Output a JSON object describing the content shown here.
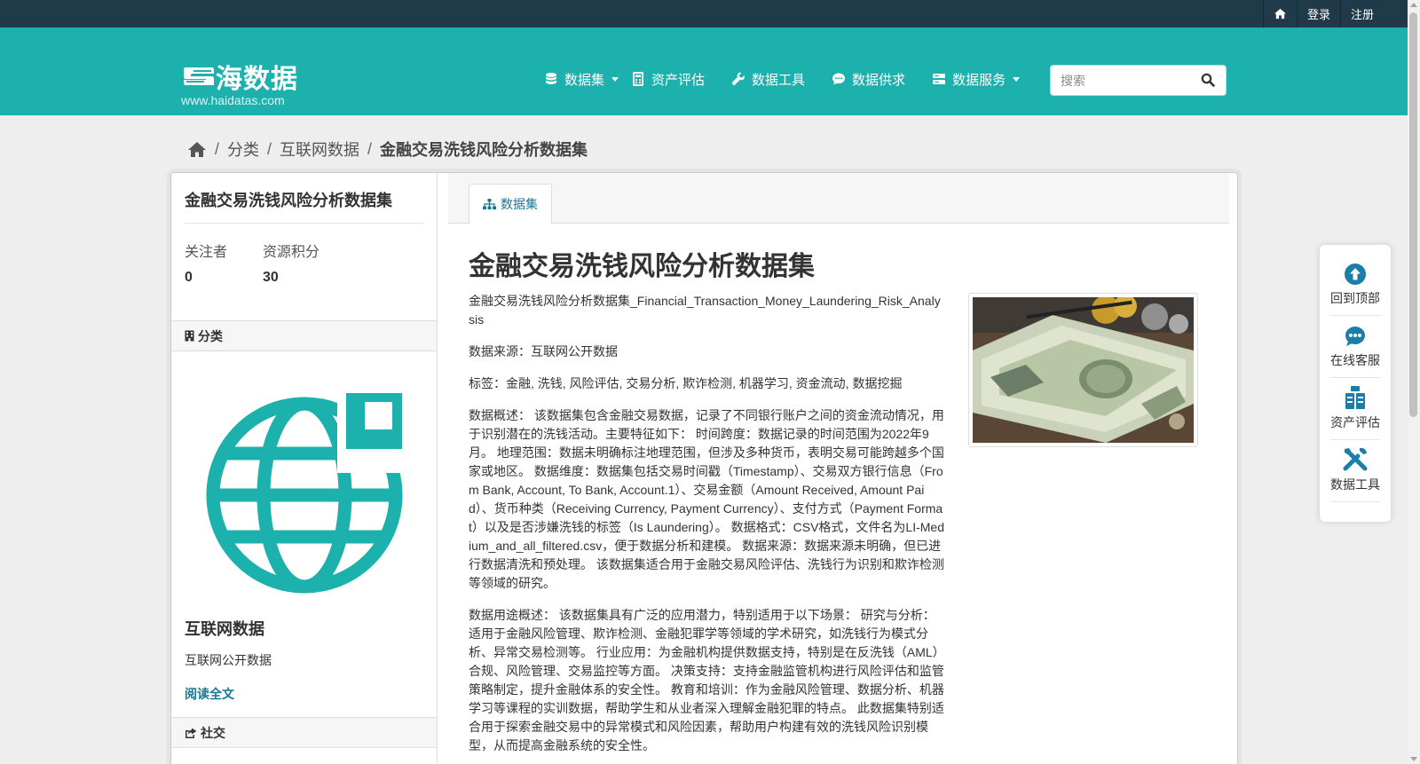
{
  "account_bar": {
    "icon": "home-icon",
    "login_label": "登录",
    "register_label": "注册"
  },
  "brand": {
    "name": "海数据",
    "url": "www.haidatas.com",
    "logo_icon": "haidatas-logo-icon"
  },
  "nav": {
    "items": [
      {
        "label": "数据集",
        "icon": "database-icon",
        "dropdown": true
      },
      {
        "label": "资产评估",
        "icon": "calculator-icon",
        "dropdown": false
      },
      {
        "label": "数据工具",
        "icon": "wrench-icon",
        "dropdown": false
      },
      {
        "label": "数据供求",
        "icon": "chat-icon",
        "dropdown": false
      },
      {
        "label": "数据服务",
        "icon": "server-icon",
        "dropdown": true
      }
    ]
  },
  "search": {
    "placeholder": "搜索",
    "value": ""
  },
  "breadcrumb": {
    "items": [
      "分类",
      "互联网数据",
      "金融交易洗钱风险分析数据集"
    ]
  },
  "sidebar": {
    "title": "金融交易洗钱风险分析数据集",
    "stats": [
      {
        "label": "关注者",
        "value": "0"
      },
      {
        "label": "资源积分",
        "value": "30"
      }
    ],
    "category_heading": "分类",
    "category_name": "互联网数据",
    "category_desc": "互联网公开数据",
    "read_more": "阅读全文",
    "social_heading": "社交"
  },
  "main": {
    "tab_label": "数据集",
    "title": "金融交易洗钱风险分析数据集",
    "paragraphs": [
      "金融交易洗钱风险分析数据集_Financial_Transaction_Money_Laundering_Risk_Analysis",
      "数据来源：互联网公开数据",
      "标签：金融, 洗钱, 风险评估, 交易分析, 欺诈检测, 机器学习, 资金流动, 数据挖掘",
      "数据概述： 该数据集包含金融交易数据，记录了不同银行账户之间的资金流动情况，用于识别潜在的洗钱活动。主要特征如下： 时间跨度：数据记录的时间范围为2022年9月。 地理范围：数据未明确标注地理范围，但涉及多种货币，表明交易可能跨越多个国家或地区。 数据维度：数据集包括交易时间戳（Timestamp）、交易双方银行信息（From Bank, Account, To Bank, Account.1）、交易金额（Amount Received, Amount Paid）、货币种类（Receiving Currency, Payment Currency）、支付方式（Payment Format）以及是否涉嫌洗钱的标签（Is Laundering）。 数据格式：CSV格式，文件名为LI-Medium_and_all_filtered.csv，便于数据分析和建模。 数据来源：数据来源未明确，但已进行数据清洗和预处理。 该数据集适合用于金融交易风险评估、洗钱行为识别和欺诈检测等领域的研究。",
      "数据用途概述： 该数据集具有广泛的应用潜力，特别适用于以下场景： 研究与分析：适用于金融风险管理、欺诈检测、金融犯罪学等领域的学术研究，如洗钱行为模式分析、异常交易检测等。 行业应用：为金融机构提供数据支持，特别是在反洗钱（AML）合规、风险管理、交易监控等方面。 决策支持：支持金融监管机构进行风险评估和监管策略制定，提升金融体系的安全性。 教育和培训：作为金融风险管理、数据分析、机器学习等课程的实训数据，帮助学生和从业者深入理解金融犯罪的特点。 此数据集特别适合用于探索金融交易中的异常模式和风险因素，帮助用户构建有效的洗钱风险识别模型，从而提高金融系统的安全性。"
    ],
    "image_icon": "money-cash-photo"
  },
  "float_tools": [
    {
      "label": "回到顶部",
      "icon": "arrow-up-circle-icon"
    },
    {
      "label": "在线客服",
      "icon": "customer-service-icon"
    },
    {
      "label": "资产评估",
      "icon": "asset-evaluation-icon"
    },
    {
      "label": "数据工具",
      "icon": "tools-icon"
    }
  ],
  "colors": {
    "accent": "#1db1ad",
    "topbar": "#1f3a48",
    "link": "#187794"
  }
}
